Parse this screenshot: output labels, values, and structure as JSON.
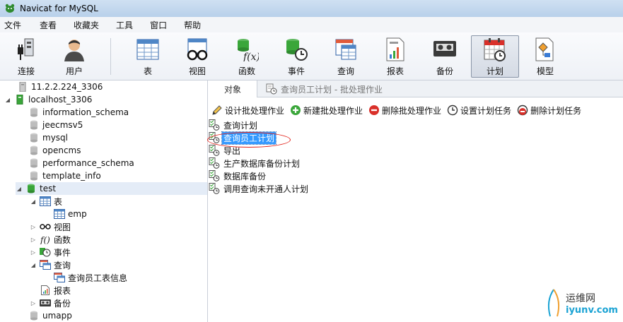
{
  "window": {
    "title": "Navicat for MySQL"
  },
  "menu": [
    "文件",
    "查看",
    "收藏夹",
    "工具",
    "窗口",
    "帮助"
  ],
  "toolbar": [
    {
      "label": "连接",
      "icon": "connection-plug-icon"
    },
    {
      "label": "用户",
      "icon": "user-icon"
    },
    {
      "label": "表",
      "icon": "table-icon"
    },
    {
      "label": "视图",
      "icon": "view-glasses-icon"
    },
    {
      "label": "函数",
      "icon": "function-icon"
    },
    {
      "label": "事件",
      "icon": "event-clock-icon"
    },
    {
      "label": "查询",
      "icon": "query-icon"
    },
    {
      "label": "报表",
      "icon": "report-icon"
    },
    {
      "label": "备份",
      "icon": "backup-tape-icon"
    },
    {
      "label": "计划",
      "icon": "schedule-calendar-icon",
      "active": true
    },
    {
      "label": "模型",
      "icon": "model-icon"
    }
  ],
  "sidebar": {
    "items": [
      {
        "label": "11.2.2.224_3306",
        "level": 0,
        "icon": "server-off-icon",
        "toggle": ""
      },
      {
        "label": "localhost_3306",
        "level": 0,
        "icon": "server-on-icon",
        "toggle": "expanded"
      },
      {
        "label": "information_schema",
        "level": 1,
        "icon": "database-gray-icon",
        "toggle": ""
      },
      {
        "label": "jeecmsv5",
        "level": 1,
        "icon": "database-gray-icon",
        "toggle": ""
      },
      {
        "label": "mysql",
        "level": 1,
        "icon": "database-gray-icon",
        "toggle": ""
      },
      {
        "label": "opencms",
        "level": 1,
        "icon": "database-gray-icon",
        "toggle": ""
      },
      {
        "label": "performance_schema",
        "level": 1,
        "icon": "database-gray-icon",
        "toggle": ""
      },
      {
        "label": "template_info",
        "level": 1,
        "icon": "database-gray-icon",
        "toggle": ""
      },
      {
        "label": "test",
        "level": 1,
        "icon": "database-green-icon",
        "toggle": "expanded",
        "selected": true
      },
      {
        "label": "表",
        "level": 2,
        "icon": "table-icon",
        "toggle": "expanded"
      },
      {
        "label": "emp",
        "level": 3,
        "icon": "table-icon",
        "toggle": ""
      },
      {
        "label": "视图",
        "level": 2,
        "icon": "view-glasses-icon",
        "toggle": "collapsed"
      },
      {
        "label": "函数",
        "level": 2,
        "icon": "function-icon",
        "toggle": "collapsed"
      },
      {
        "label": "事件",
        "level": 2,
        "icon": "event-clock-icon",
        "toggle": "collapsed"
      },
      {
        "label": "查询",
        "level": 2,
        "icon": "query-icon",
        "toggle": "expanded"
      },
      {
        "label": "查询员工表信息",
        "level": 3,
        "icon": "query-icon",
        "toggle": ""
      },
      {
        "label": "报表",
        "level": 2,
        "icon": "report-icon",
        "toggle": ""
      },
      {
        "label": "备份",
        "level": 2,
        "icon": "backup-tape-icon",
        "toggle": "collapsed"
      },
      {
        "label": "umapp",
        "level": 1,
        "icon": "database-gray-icon",
        "toggle": ""
      }
    ]
  },
  "tabs": [
    {
      "label": "对象",
      "active": true
    },
    {
      "label": "查询员工计划 - 批处理作业",
      "active": false
    }
  ],
  "actions": [
    {
      "label": "设计批处理作业",
      "icon": "design-pencil-icon"
    },
    {
      "label": "新建批处理作业",
      "icon": "add-green-icon"
    },
    {
      "label": "删除批处理作业",
      "icon": "delete-red-icon"
    },
    {
      "label": "设置计划任务",
      "icon": "clock-icon"
    },
    {
      "label": "删除计划任务",
      "icon": "delete-schedule-icon"
    }
  ],
  "jobs": [
    {
      "label": "查询计划"
    },
    {
      "label": "查询员工计划",
      "selected": true
    },
    {
      "label": "导出"
    },
    {
      "label": "生产数据库备份计划"
    },
    {
      "label": "数据库备份"
    },
    {
      "label": "调用查询未开通人计划"
    }
  ],
  "watermark": {
    "cn": "运维网",
    "url": "iyunv.com"
  },
  "colors": {
    "selection": "#3399ff",
    "highlight_oval": "#e2231a",
    "accent_green": "#3aa63a"
  }
}
